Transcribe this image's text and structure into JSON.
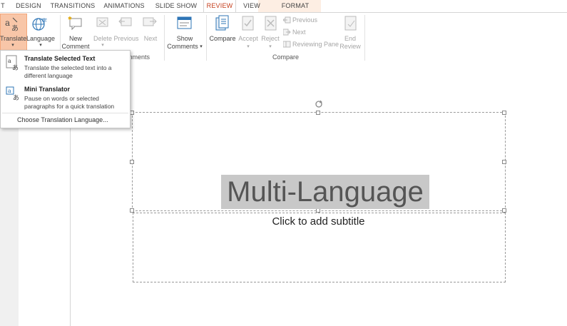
{
  "tabs": [
    {
      "label": "T"
    },
    {
      "label": "DESIGN"
    },
    {
      "label": "TRANSITIONS"
    },
    {
      "label": "ANIMATIONS"
    },
    {
      "label": "SLIDE SHOW"
    },
    {
      "label": "REVIEW"
    },
    {
      "label": "VIEW"
    },
    {
      "label": "FORMAT"
    }
  ],
  "ribbon": {
    "translate": "Translate",
    "language": "Language",
    "new_comment_line1": "New",
    "new_comment_line2": "Comment",
    "delete": "Delete",
    "previous": "Previous",
    "next": "Next",
    "show_comments_line1": "Show",
    "show_comments_line2": "Comments",
    "compare": "Compare",
    "accept": "Accept",
    "reject": "Reject",
    "previous_small": "Previous",
    "next_small": "Next",
    "reviewing_pane": "Reviewing Pane",
    "end_review_line1": "End",
    "end_review_line2": "Review",
    "comments_group_label": "mments",
    "compare_group_label": "Compare"
  },
  "dropdown": {
    "translate_selected_title": "Translate Selected Text",
    "translate_selected_desc": "Translate the selected text into a different language",
    "mini_translator_title": "Mini Translator",
    "mini_translator_desc": "Pause on words or selected paragraphs for a quick translation",
    "choose_language": "Choose Translation Language..."
  },
  "slide": {
    "title": "Multi-Language",
    "subtitle_placeholder": "Click to add subtitle"
  },
  "colors": {
    "accent": "#c43e1c",
    "translate_highlight": "#f8c6a8",
    "format_tab_bg": "#fdeee3"
  }
}
